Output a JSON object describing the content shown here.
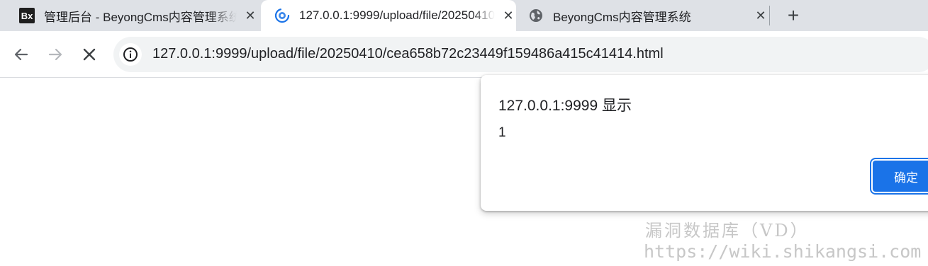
{
  "tabs": [
    {
      "title": "管理后台 - BeyongCms内容管理系统",
      "favicon": "bx-logo",
      "favicon_text": "Bx",
      "active": false
    },
    {
      "title": "127.0.0.1:9999/upload/file/20250410/cea658b72c23449f159486a415c41414.html",
      "favicon": "loading-spinner-icon",
      "active": true
    },
    {
      "title": "BeyongCms内容管理系统",
      "favicon": "globe-icon",
      "active": false
    }
  ],
  "toolbar": {
    "url": "127.0.0.1:9999/upload/file/20250410/cea658b72c23449f159486a415c41414.html"
  },
  "dialog": {
    "title": "127.0.0.1:9999 显示",
    "message": "1",
    "ok_label": "确定"
  },
  "watermark": {
    "line1": "漏洞数据库（VD）",
    "line2": "https://wiki.shikangsi.com"
  },
  "colors": {
    "tabstrip_bg": "#dee1e6",
    "accent": "#1a73e8",
    "spinner": "#1a73e8"
  }
}
